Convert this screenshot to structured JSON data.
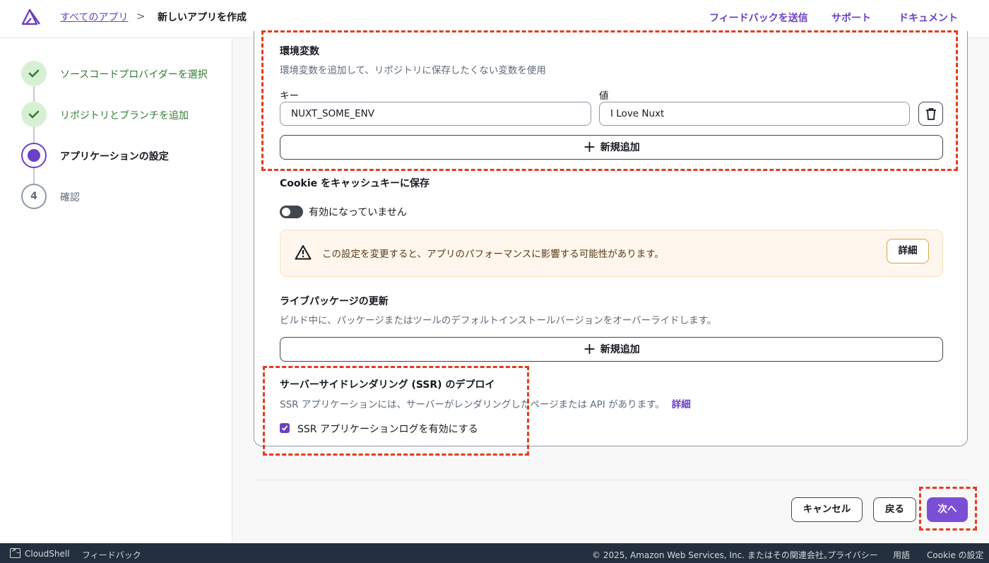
{
  "header": {
    "breadcrumb_root": "すべてのアプリ",
    "breadcrumb_separator": ">",
    "breadcrumb_current": "新しいアプリを作成",
    "links": [
      "フィードバックを送信",
      "サポート",
      "ドキュメント"
    ]
  },
  "steps": [
    {
      "label": "ソースコードプロバイダーを選択",
      "state": "done"
    },
    {
      "label": "リポジトリとブランチを追加",
      "state": "done"
    },
    {
      "label": "アプリケーションの設定",
      "state": "current"
    },
    {
      "label": "確認",
      "state": "todo",
      "number": "4"
    }
  ],
  "env": {
    "title": "環境変数",
    "description": "環境変数を追加して、リポジトリに保存したくない変数を使用",
    "key_label": "キー",
    "value_label": "値",
    "key_value": "NUXT_SOME_ENV",
    "value_value": "I Love Nuxt",
    "add_label": "新規追加"
  },
  "cookie": {
    "title": "Cookie をキャッシュキーに保存",
    "toggle_label": "有効になっていません",
    "alert_text": "この設定を変更すると、アプリのパフォーマンスに影響する可能性があります。",
    "alert_button": "詳細"
  },
  "live_packages": {
    "title": "ライブパッケージの更新",
    "description": "ビルド中に、パッケージまたはツールのデフォルトインストールバージョンをオーバーライドします。",
    "add_label": "新規追加"
  },
  "ssr": {
    "title": "サーバーサイドレンダリング (SSR) のデプロイ",
    "description": "SSR アプリケーションには、サーバーがレンダリングしたページまたは API があります。",
    "details_link": "詳細",
    "checkbox_label": "SSR アプリケーションログを有効にする"
  },
  "actions": {
    "cancel": "キャンセル",
    "back": "戻る",
    "next": "次へ"
  },
  "footer": {
    "cloudshell": "CloudShell",
    "feedback": "フィードバック",
    "copyright": "© 2025, Amazon Web Services, Inc. またはその関連会社。",
    "privacy": "プライバシー",
    "terms": "用語",
    "cookie_settings": "Cookie の設定"
  },
  "colors": {
    "accent": "#6b40c4",
    "primary_button": "#7b4fd4",
    "success": "#2e7d32",
    "warning_bg": "#fff7ee",
    "annotation": "#e8391d",
    "footer_bg": "#232f3e"
  }
}
